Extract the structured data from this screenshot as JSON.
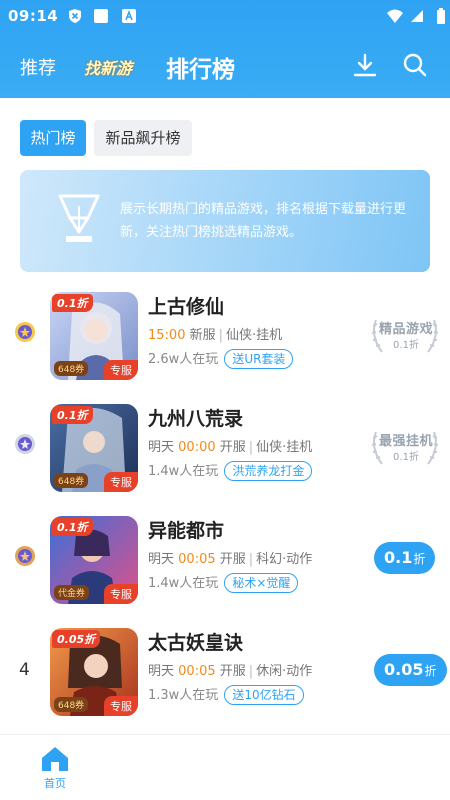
{
  "status_bar": {
    "time": "09:14"
  },
  "nav": {
    "tabs": [
      "推荐",
      "找新游",
      "排行榜"
    ],
    "icons": [
      "download-icon",
      "search-icon"
    ]
  },
  "filters": [
    "热门榜",
    "新品飙升榜"
  ],
  "banner": {
    "text": "展示长期热门的精品游戏，排名根据下载量进行更新，关注热门榜挑选精品游戏。"
  },
  "games": [
    {
      "rank_type": "medal-gold",
      "title": "上古修仙",
      "cover_discount": "0.1折",
      "cover_ticket": "648券",
      "cover_server": "专服",
      "time": "15:00",
      "status": "新服",
      "genre": "仙侠·挂机",
      "players": "2.6w人在玩",
      "tag": "送UR套装",
      "badge": {
        "main": "精品游戏",
        "sub": "0.1折"
      }
    },
    {
      "rank_type": "medal-silver",
      "title": "九州八荒录",
      "cover_discount": "0.1折",
      "cover_ticket": "648券",
      "cover_server": "专服",
      "day": "明天",
      "time": "00:00",
      "status": "开服",
      "genre": "仙侠·挂机",
      "players": "1.4w人在玩",
      "tag": "洪荒养龙打金",
      "badge": {
        "main": "最强挂机",
        "sub": "0.1折"
      }
    },
    {
      "rank_type": "medal-bronze",
      "title": "异能都市",
      "cover_discount": "0.1折",
      "cover_ticket": "代金券",
      "cover_server": "专服",
      "day": "明天",
      "time": "00:05",
      "status": "开服",
      "genre": "科幻·动作",
      "players": "1.4w人在玩",
      "tag": "秘术×觉醒",
      "discount_btn": {
        "value": "0.1",
        "suffix": "折"
      }
    },
    {
      "rank_num": "4",
      "title": "太古妖皇诀",
      "cover_discount": "0.05折",
      "cover_ticket": "648券",
      "cover_server": "专服",
      "day": "明天",
      "time": "00:05",
      "status": "开服",
      "genre": "休闲·动作",
      "players": "1.3w人在玩",
      "tag": "送10亿钻石",
      "discount_btn": {
        "value": "0.05",
        "suffix": "折"
      }
    }
  ],
  "tabbar": {
    "home_label": "首页"
  },
  "colors": {
    "primary": "#2fa3f3",
    "accent_orange": "#f08a1a",
    "cover_red": "#e8412a"
  }
}
